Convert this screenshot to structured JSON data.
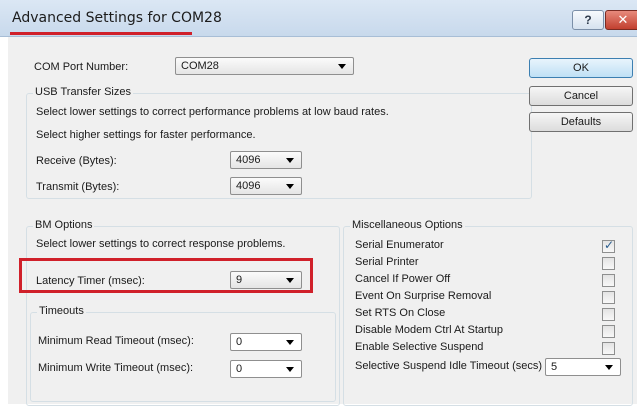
{
  "window": {
    "title": "Advanced Settings for COM28",
    "help_label": "?",
    "close_label": "✕"
  },
  "com_port": {
    "label": "COM Port Number:",
    "value": "COM28"
  },
  "usb_transfer": {
    "title": "USB Transfer Sizes",
    "hint_low": "Select lower settings to correct performance problems at low baud rates.",
    "hint_high": "Select higher settings for faster performance.",
    "receive_label": "Receive (Bytes):",
    "receive_value": "4096",
    "transmit_label": "Transmit (Bytes):",
    "transmit_value": "4096"
  },
  "buttons": {
    "ok": "OK",
    "cancel": "Cancel",
    "defaults": "Defaults"
  },
  "bm_options": {
    "title": "BM Options",
    "hint": "Select lower settings to correct response problems.",
    "latency_label": "Latency Timer (msec):",
    "latency_value": "9"
  },
  "timeouts": {
    "title": "Timeouts",
    "read_label": "Minimum Read Timeout (msec):",
    "read_value": "0",
    "write_label": "Minimum Write Timeout (msec):",
    "write_value": "0"
  },
  "misc": {
    "title": "Miscellaneous Options",
    "options": [
      {
        "label": "Serial Enumerator",
        "checked": true
      },
      {
        "label": "Serial Printer",
        "checked": false
      },
      {
        "label": "Cancel If Power Off",
        "checked": false
      },
      {
        "label": "Event On Surprise Removal",
        "checked": false
      },
      {
        "label": "Set RTS On Close",
        "checked": false
      },
      {
        "label": "Disable Modem Ctrl At Startup",
        "checked": false
      },
      {
        "label": "Enable Selective Suspend",
        "checked": false
      }
    ],
    "idle_label": "Selective Suspend Idle Timeout (secs)",
    "idle_value": "5"
  },
  "colors": {
    "highlight": "#d0202a",
    "title_bar": "#c8d9ec",
    "face": "#f0f0f0"
  },
  "icons": {
    "help": "help-icon",
    "close": "close-icon",
    "dropdown": "chevron-down-icon",
    "check": "checkmark-icon"
  }
}
